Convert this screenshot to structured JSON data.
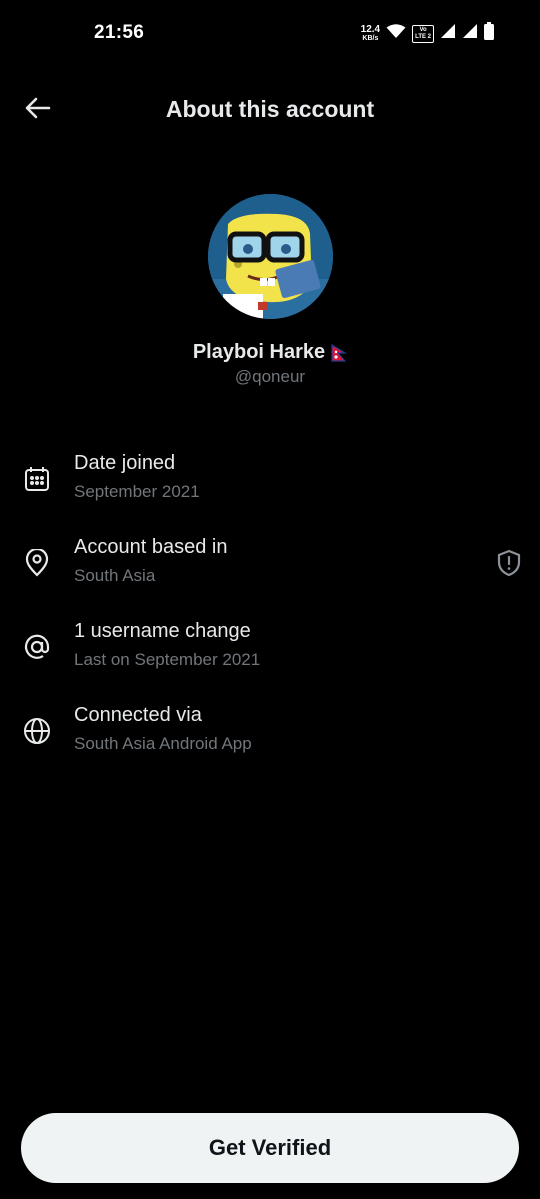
{
  "status_bar": {
    "time": "21:56",
    "net_speed_value": "12.4",
    "net_speed_unit": "KB/s",
    "network_badge_top": "Vo",
    "network_badge_bottom": "LTE 2",
    "icons": [
      "wifi-icon",
      "lte-icon",
      "signal-icon",
      "signal-icon",
      "battery-icon"
    ]
  },
  "header": {
    "title": "About this account",
    "back_icon": "arrow-left-icon"
  },
  "profile": {
    "display_name": "Playboi Harke",
    "handle": "@qoneur",
    "flag_icon": "nepal-flag-icon"
  },
  "info_items": [
    {
      "icon": "calendar-icon",
      "label": "Date joined",
      "sub": "September 2021"
    },
    {
      "icon": "location-pin-icon",
      "label": "Account based in",
      "sub": "South Asia",
      "side_icon": "shield-alert-icon"
    },
    {
      "icon": "at-sign-icon",
      "label": "1 username change",
      "sub": "Last on September 2021"
    },
    {
      "icon": "globe-icon",
      "label": "Connected via",
      "sub": "South Asia Android App"
    }
  ],
  "cta": {
    "label": "Get Verified"
  },
  "colors": {
    "background": "#000000",
    "primary_text": "#e7e9ea",
    "secondary_text": "#71767b",
    "cta_background": "#eff3f4",
    "cta_text": "#0f1419"
  }
}
